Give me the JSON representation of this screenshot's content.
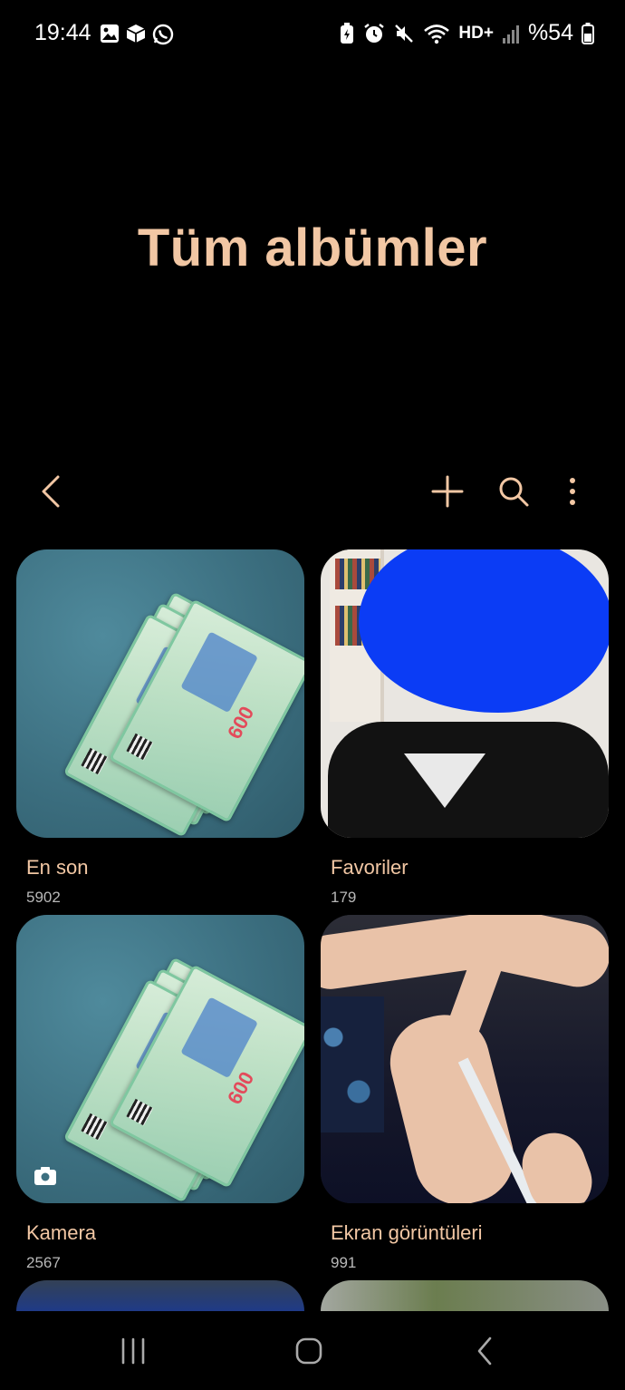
{
  "status_bar": {
    "time": "19:44",
    "left_icons": [
      "gallery-icon",
      "package-icon",
      "whatsapp-icon"
    ],
    "right_icons": [
      "battery-saver-icon",
      "alarm-icon",
      "mute-icon",
      "wifi-icon",
      "hd-plus-icon",
      "signal-icon"
    ],
    "network_label": "HD+",
    "battery": "%54"
  },
  "header": {
    "title": "Tüm albümler"
  },
  "toolbar": {
    "icons": [
      "back-icon",
      "add-icon",
      "search-icon",
      "more-options-icon"
    ]
  },
  "albums": [
    {
      "name": "En son",
      "count": "5902"
    },
    {
      "name": "Favoriler",
      "count": "179"
    },
    {
      "name": "Kamera",
      "count": "2567"
    },
    {
      "name": "Ekran görüntüleri",
      "count": "991"
    }
  ],
  "colors": {
    "accent": "#f2c7a4",
    "background": "#000000",
    "count_text": "#b8b8b8"
  },
  "nav_bar": {
    "icons": [
      "recent-apps-icon",
      "home-icon",
      "back-nav-icon"
    ]
  }
}
